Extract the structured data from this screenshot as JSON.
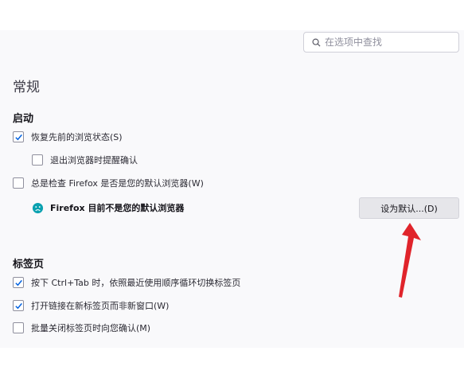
{
  "search": {
    "placeholder": "在选项中查找"
  },
  "section_title": "常规",
  "startup": {
    "heading": "启动",
    "restore_session": {
      "label": "恢复先前的浏览状态(S)",
      "checked": true
    },
    "warn_on_quit": {
      "label": "退出浏览器时提醒确认",
      "checked": false
    },
    "check_default": {
      "label": "总是检查 Firefox 是否是您的默认浏览器(W)",
      "checked": false
    },
    "default_status": "Firefox 目前不是您的默认浏览器",
    "set_default_button": "设为默认...(D)"
  },
  "tabs": {
    "heading": "标签页",
    "ctrl_tab": {
      "label": "按下 Ctrl+Tab 时，依照最近使用顺序循环切换标签页",
      "checked": true
    },
    "open_links_in_tabs": {
      "label": "打开链接在新标签页而非新窗口(W)",
      "checked": true
    },
    "confirm_close": {
      "label": "批量关闭标签页时向您确认(M)",
      "checked": false
    }
  },
  "colors": {
    "accent": "#0061e0",
    "arrow": "#e0242b",
    "status_icon": "#0aa1b0"
  },
  "icons": {
    "search": "search-icon",
    "checkmark": "checkmark-icon",
    "status": "sad-face-icon",
    "annotation": "red-arrow-icon"
  }
}
